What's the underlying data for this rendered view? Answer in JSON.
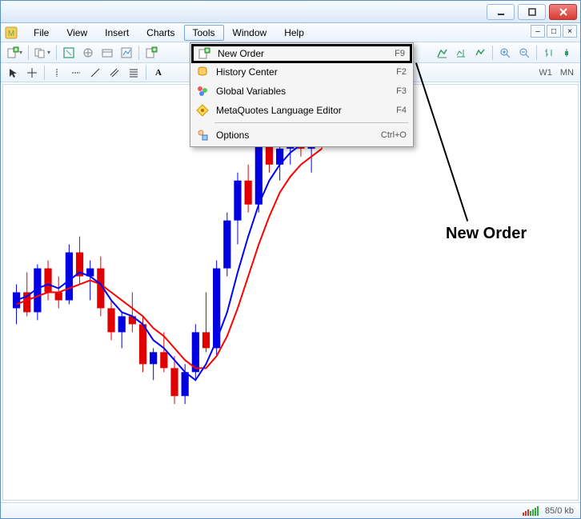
{
  "menubar": {
    "items": [
      "File",
      "View",
      "Insert",
      "Charts",
      "Tools",
      "Window",
      "Help"
    ],
    "open_index": 4
  },
  "dropdown": {
    "items": [
      {
        "label": "New Order",
        "shortcut": "F9",
        "icon": "plus",
        "highlighted": true
      },
      {
        "label": "History Center",
        "shortcut": "F2",
        "icon": "db"
      },
      {
        "label": "Global Variables",
        "shortcut": "F3",
        "icon": "globe"
      },
      {
        "label": "MetaQuotes Language Editor",
        "shortcut": "F4",
        "icon": "editor"
      },
      {
        "sep": true
      },
      {
        "label": "Options",
        "shortcut": "Ctrl+O",
        "icon": "options"
      }
    ]
  },
  "timeframes": [
    "W1",
    "MN"
  ],
  "annotation": {
    "text": "New Order"
  },
  "statusbar": {
    "transfer": "85/0 kb"
  },
  "chart_data": {
    "type": "candlestick",
    "title": "",
    "xlabel": "",
    "ylabel": "",
    "ylim": [
      0,
      100
    ],
    "overlays": [
      {
        "name": "MA-fast",
        "color": "#0000ff"
      },
      {
        "name": "MA-slow",
        "color": "#ff0000"
      }
    ],
    "candles": [
      {
        "o": 46,
        "h": 52,
        "l": 42,
        "c": 50,
        "color": "blue"
      },
      {
        "o": 50,
        "h": 55,
        "l": 44,
        "c": 45,
        "color": "red"
      },
      {
        "o": 45,
        "h": 57,
        "l": 43,
        "c": 56,
        "color": "blue"
      },
      {
        "o": 56,
        "h": 58,
        "l": 48,
        "c": 50,
        "color": "red"
      },
      {
        "o": 50,
        "h": 54,
        "l": 46,
        "c": 48,
        "color": "red"
      },
      {
        "o": 48,
        "h": 62,
        "l": 47,
        "c": 60,
        "color": "blue"
      },
      {
        "o": 60,
        "h": 64,
        "l": 52,
        "c": 54,
        "color": "red"
      },
      {
        "o": 54,
        "h": 58,
        "l": 48,
        "c": 56,
        "color": "blue"
      },
      {
        "o": 56,
        "h": 59,
        "l": 44,
        "c": 46,
        "color": "red"
      },
      {
        "o": 46,
        "h": 48,
        "l": 38,
        "c": 40,
        "color": "red"
      },
      {
        "o": 40,
        "h": 45,
        "l": 36,
        "c": 44,
        "color": "blue"
      },
      {
        "o": 44,
        "h": 50,
        "l": 40,
        "c": 42,
        "color": "red"
      },
      {
        "o": 42,
        "h": 44,
        "l": 30,
        "c": 32,
        "color": "red"
      },
      {
        "o": 32,
        "h": 36,
        "l": 28,
        "c": 35,
        "color": "blue"
      },
      {
        "o": 35,
        "h": 40,
        "l": 30,
        "c": 31,
        "color": "red"
      },
      {
        "o": 31,
        "h": 34,
        "l": 22,
        "c": 24,
        "color": "red"
      },
      {
        "o": 24,
        "h": 32,
        "l": 22,
        "c": 30,
        "color": "blue"
      },
      {
        "o": 30,
        "h": 42,
        "l": 28,
        "c": 40,
        "color": "blue"
      },
      {
        "o": 40,
        "h": 50,
        "l": 35,
        "c": 36,
        "color": "red"
      },
      {
        "o": 36,
        "h": 58,
        "l": 34,
        "c": 56,
        "color": "blue"
      },
      {
        "o": 56,
        "h": 70,
        "l": 54,
        "c": 68,
        "color": "blue"
      },
      {
        "o": 68,
        "h": 80,
        "l": 62,
        "c": 78,
        "color": "blue"
      },
      {
        "o": 78,
        "h": 82,
        "l": 70,
        "c": 72,
        "color": "red"
      },
      {
        "o": 72,
        "h": 90,
        "l": 70,
        "c": 88,
        "color": "blue"
      },
      {
        "o": 88,
        "h": 92,
        "l": 80,
        "c": 82,
        "color": "red"
      },
      {
        "o": 82,
        "h": 88,
        "l": 78,
        "c": 86,
        "color": "blue"
      },
      {
        "o": 86,
        "h": 94,
        "l": 82,
        "c": 92,
        "color": "blue"
      },
      {
        "o": 92,
        "h": 96,
        "l": 84,
        "c": 86,
        "color": "red"
      },
      {
        "o": 86,
        "h": 92,
        "l": 80,
        "c": 90,
        "color": "blue"
      },
      {
        "o": 90,
        "h": 95,
        "l": 86,
        "c": 88,
        "color": "red"
      }
    ],
    "ma_fast": [
      48,
      49,
      51,
      52,
      51,
      53,
      55,
      54,
      52,
      48,
      45,
      44,
      42,
      38,
      36,
      33,
      30,
      28,
      32,
      38,
      45,
      55,
      64,
      72,
      78,
      82,
      85,
      87,
      88,
      88
    ],
    "ma_slow": [
      47,
      48,
      49,
      50,
      50,
      51,
      52,
      53,
      52,
      50,
      48,
      46,
      44,
      41,
      39,
      36,
      33,
      31,
      31,
      34,
      39,
      46,
      54,
      62,
      69,
      75,
      79,
      82,
      84,
      86
    ]
  }
}
